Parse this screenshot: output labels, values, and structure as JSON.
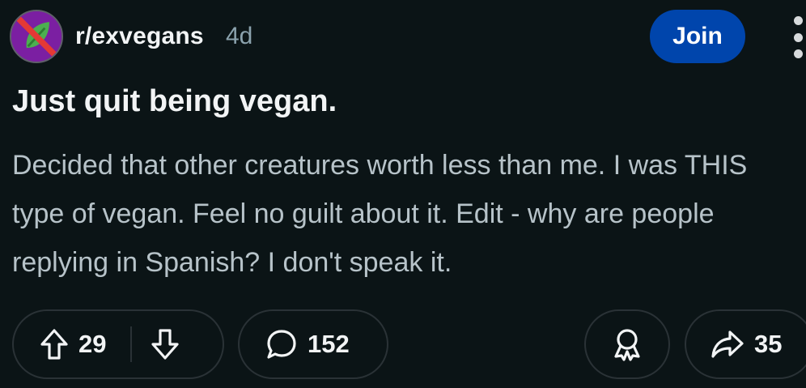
{
  "header": {
    "subreddit": "r/exvegans",
    "age": "4d",
    "join_label": "Join",
    "avatar_icon": "crossed-out-leaf-icon",
    "more_icon": "more-options-icon"
  },
  "post": {
    "title": "Just quit being vegan.",
    "body": "Decided that other creatures worth less than me. I was THIS type of vegan. Feel no guilt about it. Edit - why are people replying in Spanish? I don't speak it."
  },
  "actions": {
    "upvotes": "29",
    "comments": "152",
    "shares": "35",
    "upvote_icon": "upvote-arrow-icon",
    "downvote_icon": "downvote-arrow-icon",
    "comment_icon": "speech-bubble-icon",
    "award_icon": "award-ribbon-icon",
    "share_icon": "share-arrow-icon"
  },
  "colors": {
    "background": "#0b1416",
    "join_button": "#0045ac",
    "avatar": "#7b1fa2",
    "leaf": "#4caf50",
    "cross": "#e53935",
    "muted_text": "#8ba2ad",
    "body_text": "#b7c3c9"
  }
}
